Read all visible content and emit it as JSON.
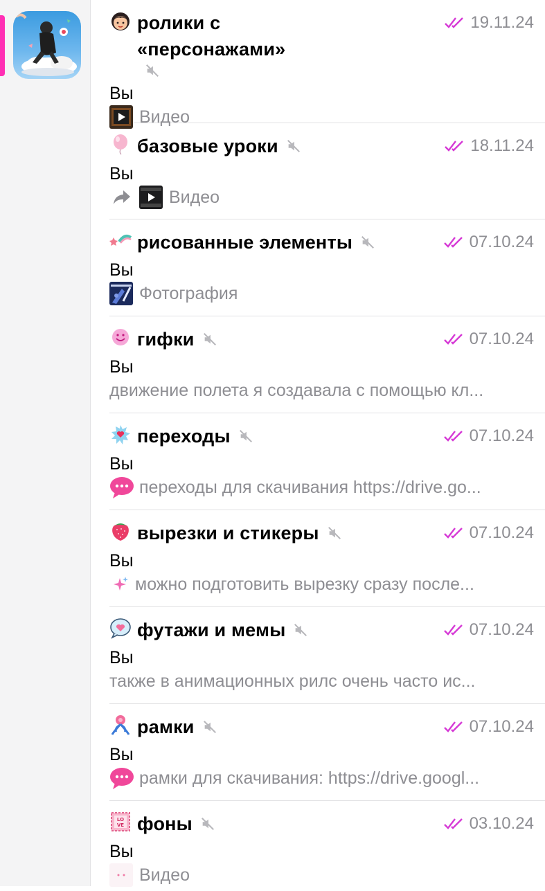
{
  "chats": [
    {
      "title": "ролики с «персонажами»",
      "date": "19.11.24",
      "sender": "Вы",
      "preview": "Видео",
      "emoji": "girl-face-icon",
      "preview_icon": "video-thumbnail"
    },
    {
      "title": "базовые уроки",
      "date": "18.11.24",
      "sender": "Вы",
      "preview": "Видео",
      "emoji": "pink-balloon-icon",
      "preview_icon": "forwarded-video-thumbnail"
    },
    {
      "title": "рисованные элементы",
      "date": "07.10.24",
      "sender": "Вы",
      "preview": "Фотография",
      "emoji": "shooting-star-icon",
      "preview_icon": "photo-thumbnail"
    },
    {
      "title": "гифки",
      "date": "07.10.24",
      "sender": "Вы",
      "preview": "движение полета я создавала с помощью кл...",
      "emoji": "smiley-face-icon",
      "preview_icon": ""
    },
    {
      "title": "переходы",
      "date": "07.10.24",
      "sender": "Вы",
      "preview": "переходы для скачивания https://drive.go...",
      "emoji": "splash-heart-icon",
      "preview_icon": "speech-bubble-icon"
    },
    {
      "title": "вырезки и стикеры",
      "date": "07.10.24",
      "sender": "Вы",
      "preview": "можно подготовить вырезку сразу после...",
      "emoji": "strawberry-icon",
      "preview_icon": "sparkles-icon"
    },
    {
      "title": "футажи и мемы",
      "date": "07.10.24",
      "sender": "Вы",
      "preview": "также в анимационных рилс очень часто ис...",
      "emoji": "heart-bubble-icon",
      "preview_icon": ""
    },
    {
      "title": "рамки",
      "date": "07.10.24",
      "sender": "Вы",
      "preview": "рамки для скачивания: https://drive.googl...",
      "emoji": "flower-bow-icon",
      "preview_icon": "speech-bubble-icon"
    },
    {
      "title": "фоны",
      "date": "03.10.24",
      "sender": "Вы",
      "preview": "Видео",
      "emoji": "love-stamp-icon",
      "preview_icon": "video-thumbnail-light"
    }
  ],
  "colors": {
    "accent": "#ff2fb4",
    "read_ticks": "#d63ad6",
    "muted_text": "#8e8e93",
    "bubble_pink": "#f0479a"
  }
}
